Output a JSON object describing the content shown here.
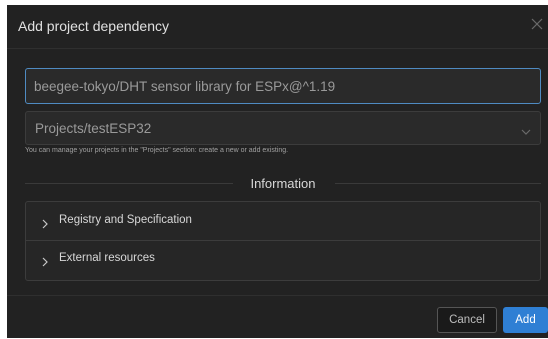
{
  "dialog": {
    "title": "Add project dependency",
    "close_icon": "close-icon"
  },
  "spec_input": {
    "value": "beegee-tokyo/DHT sensor library for ESPx@^1.19"
  },
  "project_select": {
    "value": "Projects/testESP32",
    "icon": "chevron-down-icon"
  },
  "hint": {
    "text": "You can manage your projects in the \"Projects\" section: create a new or add existing."
  },
  "information": {
    "label": "Information",
    "items": [
      {
        "label": "Registry and Specification",
        "icon": "chevron-right-icon"
      },
      {
        "label": "External resources",
        "icon": "chevron-right-icon"
      }
    ]
  },
  "footer": {
    "cancel_label": "Cancel",
    "add_label": "Add"
  },
  "colors": {
    "dialog_bg": "#222222",
    "accent": "#2f7fd4",
    "focus_border": "#4f8bc2"
  }
}
